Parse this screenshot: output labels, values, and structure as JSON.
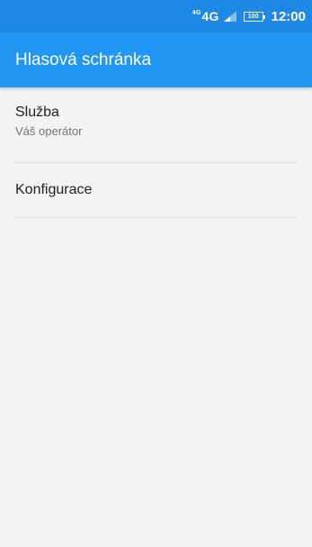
{
  "status_bar": {
    "network_superscript": "4G",
    "network_label": "4G",
    "battery_level": "100",
    "time": "12:00"
  },
  "app_bar": {
    "title": "Hlasová schránka"
  },
  "settings": {
    "items": [
      {
        "title": "Služba",
        "subtitle": "Váš operátor"
      },
      {
        "title": "Konfigurace"
      }
    ]
  },
  "colors": {
    "status_bar": "#1e88e5",
    "app_bar": "#2196f3",
    "background": "#f3f3f3",
    "divider": "#dedede"
  },
  "icons": [
    "network-4g-icon",
    "signal-icon",
    "battery-icon"
  ]
}
